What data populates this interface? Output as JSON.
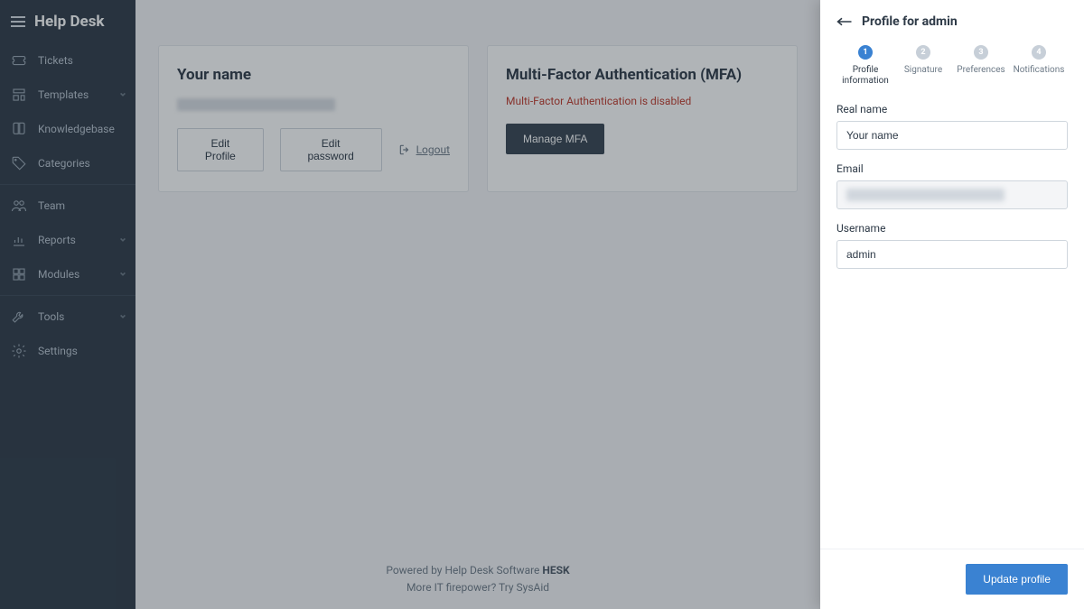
{
  "brand": "Help Desk",
  "sidebar": {
    "items": [
      {
        "label": "Tickets",
        "has_chevron": false
      },
      {
        "label": "Templates",
        "has_chevron": true
      },
      {
        "label": "Knowledgebase",
        "has_chevron": false
      },
      {
        "label": "Categories",
        "has_chevron": false
      },
      {
        "label": "Team",
        "has_chevron": false
      },
      {
        "label": "Reports",
        "has_chevron": true
      },
      {
        "label": "Modules",
        "has_chevron": true
      },
      {
        "label": "Tools",
        "has_chevron": true
      },
      {
        "label": "Settings",
        "has_chevron": false
      }
    ]
  },
  "main": {
    "name_card": {
      "title": "Your name",
      "email_redacted": "admin@example.example.exam",
      "edit_profile": "Edit Profile",
      "edit_password": "Edit password",
      "logout": "Logout"
    },
    "mfa_card": {
      "title": "Multi-Factor Authentication (MFA)",
      "status": "Multi-Factor Authentication is disabled",
      "manage": "Manage MFA"
    },
    "footer": {
      "line1_prefix": "Powered by ",
      "line1_link": "Help Desk Software",
      "line1_suffix": " HESK",
      "line2_prefix": "More IT firepower? Try ",
      "line2_link": "SysAid"
    }
  },
  "panel": {
    "title": "Profile for admin",
    "steps": [
      {
        "num": "1",
        "label": "Profile information"
      },
      {
        "num": "2",
        "label": "Signature"
      },
      {
        "num": "3",
        "label": "Preferences"
      },
      {
        "num": "4",
        "label": "Notifications"
      }
    ],
    "fields": {
      "real_name": {
        "label": "Real name",
        "value": "Your name"
      },
      "email": {
        "label": "Email",
        "value_redacted": "admin@example.example.exam"
      },
      "username": {
        "label": "Username",
        "value": "admin"
      }
    },
    "submit": "Update profile"
  }
}
